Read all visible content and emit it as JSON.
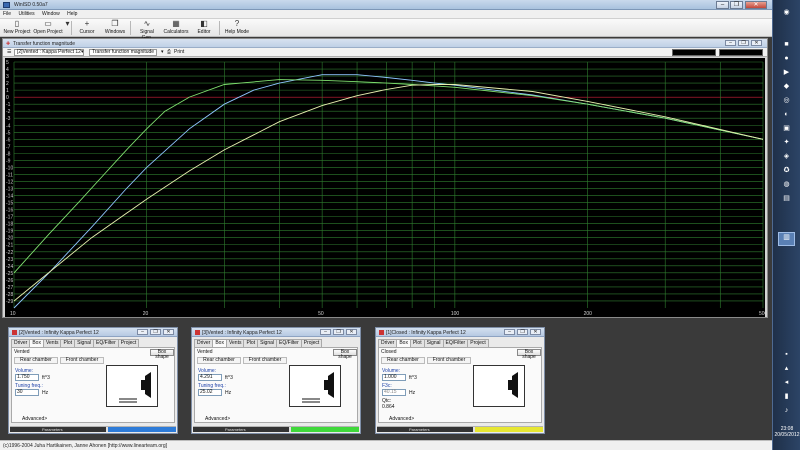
{
  "window": {
    "title": "WinISD 0.50a7",
    "min_glyph": "–",
    "max_glyph": "❐",
    "close_glyph": "✕"
  },
  "menu": [
    "File",
    "Utilities",
    "Window",
    "Help"
  ],
  "toolbar": {
    "new_project": "New Project",
    "open_project": "Open Project",
    "cursor": "Cursor",
    "windows": "Windows",
    "signal_gen": "Signal Gen.",
    "calculators": "Calculators",
    "editor": "Editor",
    "help_mode": "Help Mode"
  },
  "graph_window": {
    "title": "Transfer function magnitude",
    "project_select": "[2]Vented : Kappa Perfect 12",
    "graph_select": "Transfer function magnitude",
    "print_label": "Print"
  },
  "chart_data": {
    "type": "line",
    "x_scale": "log",
    "xlim": [
      10,
      500
    ],
    "ylim": [
      -30,
      5
    ],
    "y_ticks": [
      5,
      4,
      3,
      2,
      1,
      0,
      -1,
      -2,
      -3,
      -4,
      -5,
      -6,
      -7,
      -8,
      -9,
      -10,
      -11,
      -12,
      -13,
      -14,
      -15,
      -16,
      -17,
      -18,
      -19,
      -20,
      -21,
      -22,
      -23,
      -24,
      -25,
      -26,
      -27,
      -28,
      -29
    ],
    "x_tick_labels": [
      {
        "x": 10,
        "label": "10"
      },
      {
        "x": 20,
        "label": "20"
      },
      {
        "x": 50,
        "label": "50"
      },
      {
        "x": 100,
        "label": "100"
      },
      {
        "x": 200,
        "label": "200"
      },
      {
        "x": 500,
        "label": "500"
      }
    ],
    "x_grid": [
      10,
      20,
      30,
      40,
      50,
      60,
      70,
      80,
      90,
      100,
      200,
      300,
      400,
      500
    ],
    "reference_line_y": 0,
    "grid": true,
    "series": [
      {
        "color": "#8fc5ff",
        "x": [
          10,
          12,
          15,
          18,
          20,
          25,
          30,
          35,
          40,
          50,
          60,
          70,
          80,
          90,
          100,
          150,
          200,
          300,
          500
        ],
        "y": [
          -30,
          -25,
          -18.5,
          -13,
          -10,
          -4.5,
          -1,
          1,
          2,
          3.2,
          3.2,
          2.8,
          2.4,
          2,
          1.7,
          0.3,
          -1,
          -3,
          -6
        ]
      },
      {
        "color": "#80e070",
        "x": [
          10,
          12,
          14,
          16,
          18,
          20,
          22,
          25,
          30,
          40,
          50,
          60,
          70,
          80,
          90,
          100,
          150,
          200,
          300,
          500
        ],
        "y": [
          -25,
          -19.5,
          -15,
          -11,
          -7.5,
          -4.5,
          -2,
          0,
          1.8,
          2.5,
          2.4,
          2.2,
          2,
          1.8,
          1.6,
          1.4,
          0.2,
          -1,
          -3,
          -6
        ]
      },
      {
        "color": "#e8f0b0",
        "x": [
          10,
          15,
          20,
          25,
          30,
          40,
          50,
          60,
          70,
          80,
          90,
          100,
          150,
          200,
          300,
          500
        ],
        "y": [
          -29,
          -20,
          -14.5,
          -10.5,
          -7.5,
          -3.5,
          -1.2,
          0.2,
          1.1,
          1.7,
          1.8,
          1.8,
          0.8,
          -0.6,
          -2.8,
          -6
        ]
      }
    ]
  },
  "panels": [
    {
      "title": "[2]Vented : Infinity Kappa Perfect 12",
      "tabs": [
        "Driver",
        "Box",
        "Vents",
        "Plot",
        "Signal",
        "EQ/Filter",
        "Project"
      ],
      "active_tab": "Box",
      "box_type": "Vented",
      "box_shape": "Box shape",
      "rear_chamber": "Rear chamber",
      "front_chamber": "Front chamber",
      "volume_label": "Volume:",
      "volume": "1.750",
      "volume_unit": "ft^3",
      "tuning_label": "Tuning freq.:",
      "tuning": "30",
      "tuning_unit": "Hz",
      "advanced": "Advanced>",
      "status_label": "Parameters",
      "color": "#2d7bd8"
    },
    {
      "title": "[3]Vented : Infinity Kappa Perfect 12",
      "tabs": [
        "Driver",
        "Box",
        "Vents",
        "Plot",
        "Signal",
        "EQ/Filter",
        "Project"
      ],
      "active_tab": "Box",
      "box_type": "Vented",
      "box_shape": "Box shape",
      "rear_chamber": "Rear chamber",
      "front_chamber": "Front chamber",
      "volume_label": "Volume:",
      "volume": "4.291",
      "volume_unit": "ft^3",
      "tuning_label": "Tuning freq.:",
      "tuning": "25.02",
      "tuning_unit": "Hz",
      "advanced": "Advanced>",
      "status_label": "Parameters",
      "color": "#3fd83a"
    },
    {
      "title": "[1]Closed : Infinity Kappa Perfect 12",
      "tabs": [
        "Driver",
        "Box",
        "Plot",
        "Signal",
        "EQ/Filter",
        "Project"
      ],
      "active_tab": "Box",
      "box_type": "Closed",
      "box_shape": "Box shape",
      "rear_chamber": "Rear chamber",
      "front_chamber": "Front chamber",
      "volume_label": "Volume:",
      "volume": "1.000",
      "volume_unit": "ft^3",
      "fc_label": "F3c:",
      "fc": "40.15",
      "fc_unit": "Hz",
      "qtc_label": "Qtc:",
      "qtc": "0.864",
      "advanced": "Advanced>",
      "status_label": "Parameters",
      "color": "#e6e632"
    }
  ],
  "statusbar": {
    "text": "(c)1996-2004 Juha Hartikainen, Janne Ahonen [http://www.linearteam.org]"
  },
  "taskbar": {
    "time": "23:08",
    "date": "20/05/2012"
  }
}
